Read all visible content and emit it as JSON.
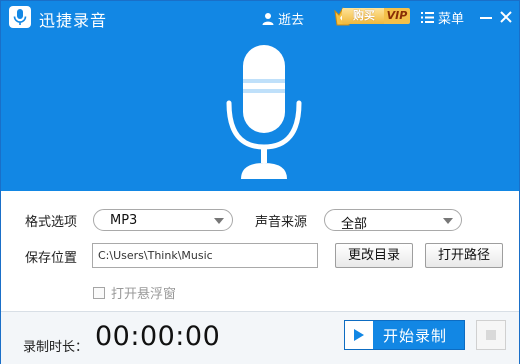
{
  "titlebar": {
    "app_title": "迅捷录音",
    "user_label": "逝去",
    "vip": {
      "buy_label": "购买",
      "vip_label": "VIP"
    },
    "menu_label": "菜单"
  },
  "settings": {
    "format": {
      "label": "格式选项",
      "value": "MP3"
    },
    "source": {
      "label": "声音来源",
      "value": "全部"
    },
    "save": {
      "label": "保存位置",
      "path": "C:\\Users\\Think\\Music",
      "change_dir_label": "更改目录",
      "open_path_label": "打开路径"
    },
    "floating_window": {
      "label": "打开悬浮窗",
      "checked": false
    }
  },
  "footer": {
    "duration_label": "录制时长：",
    "timer": "00:00:00",
    "start_label": "开始录制"
  },
  "colors": {
    "accent": "#1287e4",
    "footer_bg": "#f3f6f9",
    "vip_gold": "#f4c04a"
  },
  "icons": {
    "app": "microphone-icon",
    "user": "user-icon",
    "vip": "crown-icon",
    "menu": "menu-lines-icon",
    "minimize": "minimize-icon",
    "close": "close-icon",
    "hero": "microphone-icon",
    "record": "play-icon",
    "stop": "stop-icon"
  }
}
